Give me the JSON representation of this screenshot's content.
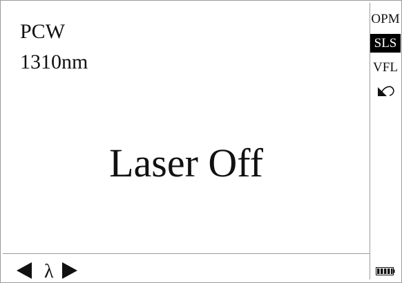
{
  "screen": {
    "mode": "PCW",
    "wavelength": "1310nm",
    "status": "Laser Off"
  },
  "nav": {
    "left_icon": "triangle-left-icon",
    "lambda_label": "λ",
    "right_icon": "triangle-right-icon"
  },
  "sidebar": {
    "items": [
      {
        "label": "OPM",
        "active": false
      },
      {
        "label": "SLS",
        "active": true
      },
      {
        "label": "VFL",
        "active": false
      }
    ],
    "back_icon": "back-arrow-icon",
    "battery_icon": "battery-icon"
  }
}
